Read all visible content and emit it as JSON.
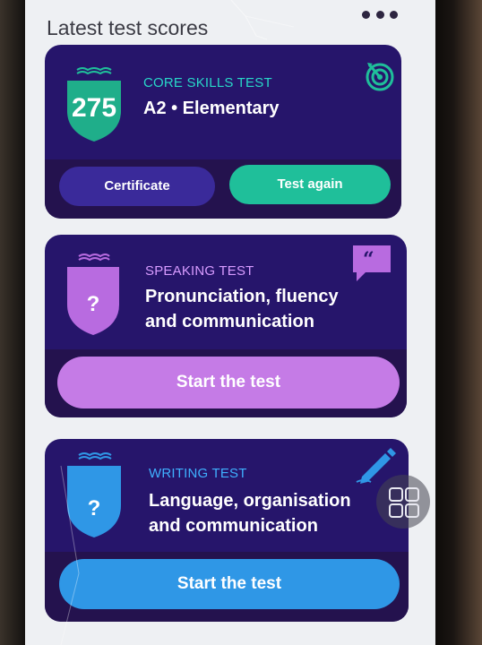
{
  "header": {
    "title": "Latest test scores"
  },
  "core": {
    "label": "CORE SKILLS TEST",
    "score": "275",
    "level": "A2 • Elementary",
    "certificate_label": "Certificate",
    "test_again_label": "Test again",
    "icon": "target-icon"
  },
  "speaking": {
    "label": "SPEAKING TEST",
    "title_line1": "Pronunciation, fluency",
    "title_line2": "and communication",
    "placeholder": "?",
    "button_label": "Start the test",
    "icon": "speech-bubble-icon"
  },
  "writing": {
    "label": "WRITING TEST",
    "title_line1": "Language, organisation",
    "title_line2": "and communication",
    "placeholder": "?",
    "button_label": "Start the test",
    "icon": "pencil-icon"
  },
  "colors": {
    "card_bg": "#26156b",
    "core_green": "#1fbf9a",
    "speaking_purple": "#b86be0",
    "writing_blue": "#2f97e6",
    "certificate_btn": "#3a2a9a"
  }
}
